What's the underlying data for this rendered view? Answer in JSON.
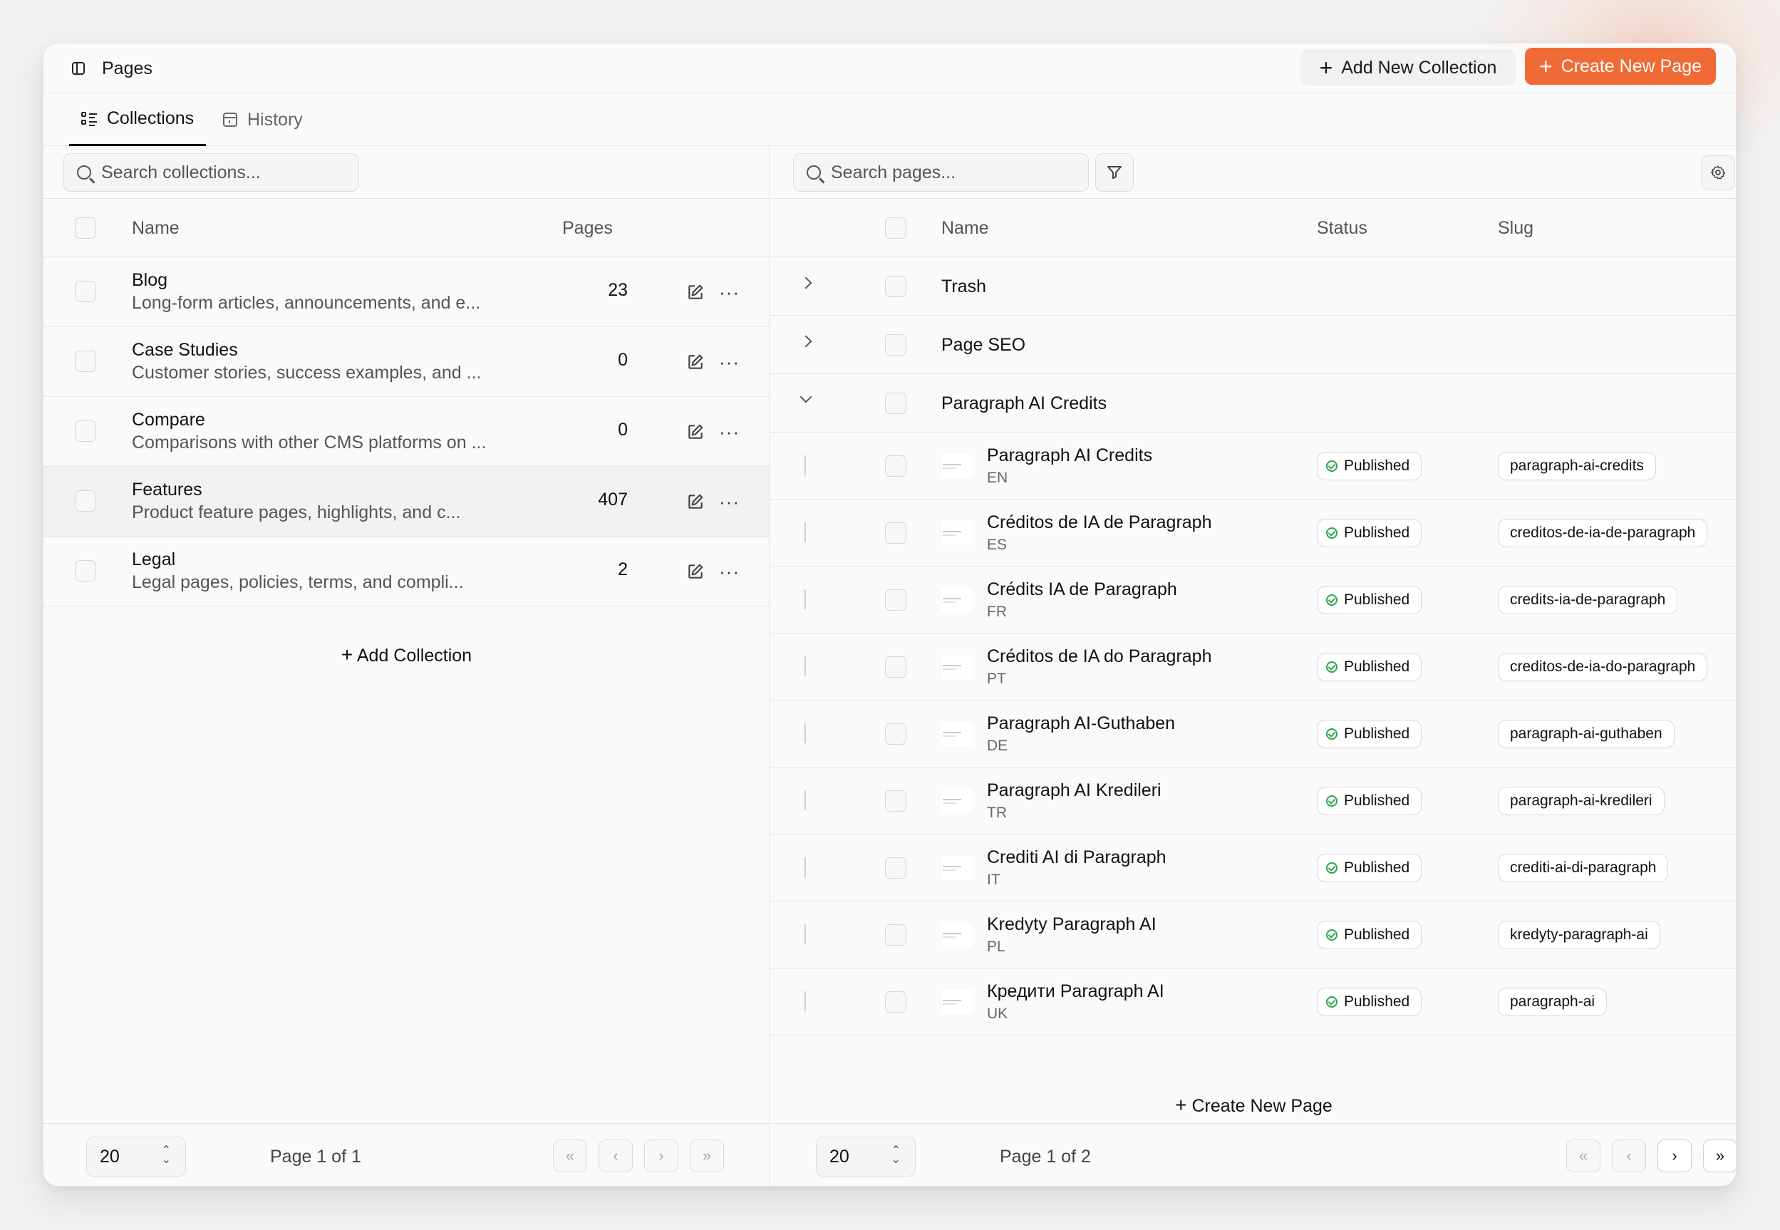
{
  "header": {
    "title": "Pages",
    "add_collection_label": "Add New Collection",
    "create_page_label": "Create New Page",
    "accent": "#f06a35"
  },
  "tabs": [
    {
      "label": "Collections",
      "active": true
    },
    {
      "label": "History",
      "active": false
    }
  ],
  "collections": {
    "search_placeholder": "Search collections...",
    "columns": {
      "name": "Name",
      "pages": "Pages"
    },
    "rows": [
      {
        "name": "Blog",
        "description": "Long-form articles, announcements, and e...",
        "count": "23"
      },
      {
        "name": "Case Studies",
        "description": "Customer stories, success examples, and ...",
        "count": "0"
      },
      {
        "name": "Compare",
        "description": "Comparisons with other CMS platforms on ...",
        "count": "0"
      },
      {
        "name": "Features",
        "description": "Product feature pages, highlights, and c...",
        "count": "407"
      },
      {
        "name": "Legal",
        "description": "Legal pages, policies, terms, and compli...",
        "count": "2"
      }
    ],
    "add_label": "Add Collection",
    "page_size": "20",
    "page_info": "Page 1 of 1"
  },
  "pages": {
    "search_placeholder": "Search pages...",
    "columns": {
      "name": "Name",
      "status": "Status",
      "slug": "Slug"
    },
    "groups": [
      {
        "name": "Trash",
        "expanded": false
      },
      {
        "name": "Page SEO",
        "expanded": false
      },
      {
        "name": "Paragraph AI Credits",
        "expanded": true
      }
    ],
    "rows": [
      {
        "name": "Paragraph AI Credits",
        "lang": "EN",
        "status": "Published",
        "slug": "paragraph-ai-credits"
      },
      {
        "name": "Créditos de IA de Paragraph",
        "lang": "ES",
        "status": "Published",
        "slug": "creditos-de-ia-de-paragraph"
      },
      {
        "name": "Crédits IA de Paragraph",
        "lang": "FR",
        "status": "Published",
        "slug": "credits-ia-de-paragraph"
      },
      {
        "name": "Créditos de IA do Paragraph",
        "lang": "PT",
        "status": "Published",
        "slug": "creditos-de-ia-do-paragraph"
      },
      {
        "name": "Paragraph AI-Guthaben",
        "lang": "DE",
        "status": "Published",
        "slug": "paragraph-ai-guthaben"
      },
      {
        "name": "Paragraph AI Kredileri",
        "lang": "TR",
        "status": "Published",
        "slug": "paragraph-ai-kredileri"
      },
      {
        "name": "Crediti AI di Paragraph",
        "lang": "IT",
        "status": "Published",
        "slug": "crediti-ai-di-paragraph"
      },
      {
        "name": "Kredyty Paragraph AI",
        "lang": "PL",
        "status": "Published",
        "slug": "kredyty-paragraph-ai"
      },
      {
        "name": "Кредити Paragraph AI",
        "lang": "UK",
        "status": "Published",
        "slug": "paragraph-ai"
      }
    ],
    "create_label": "Create New Page",
    "page_size": "20",
    "page_info": "Page 1 of 2"
  }
}
